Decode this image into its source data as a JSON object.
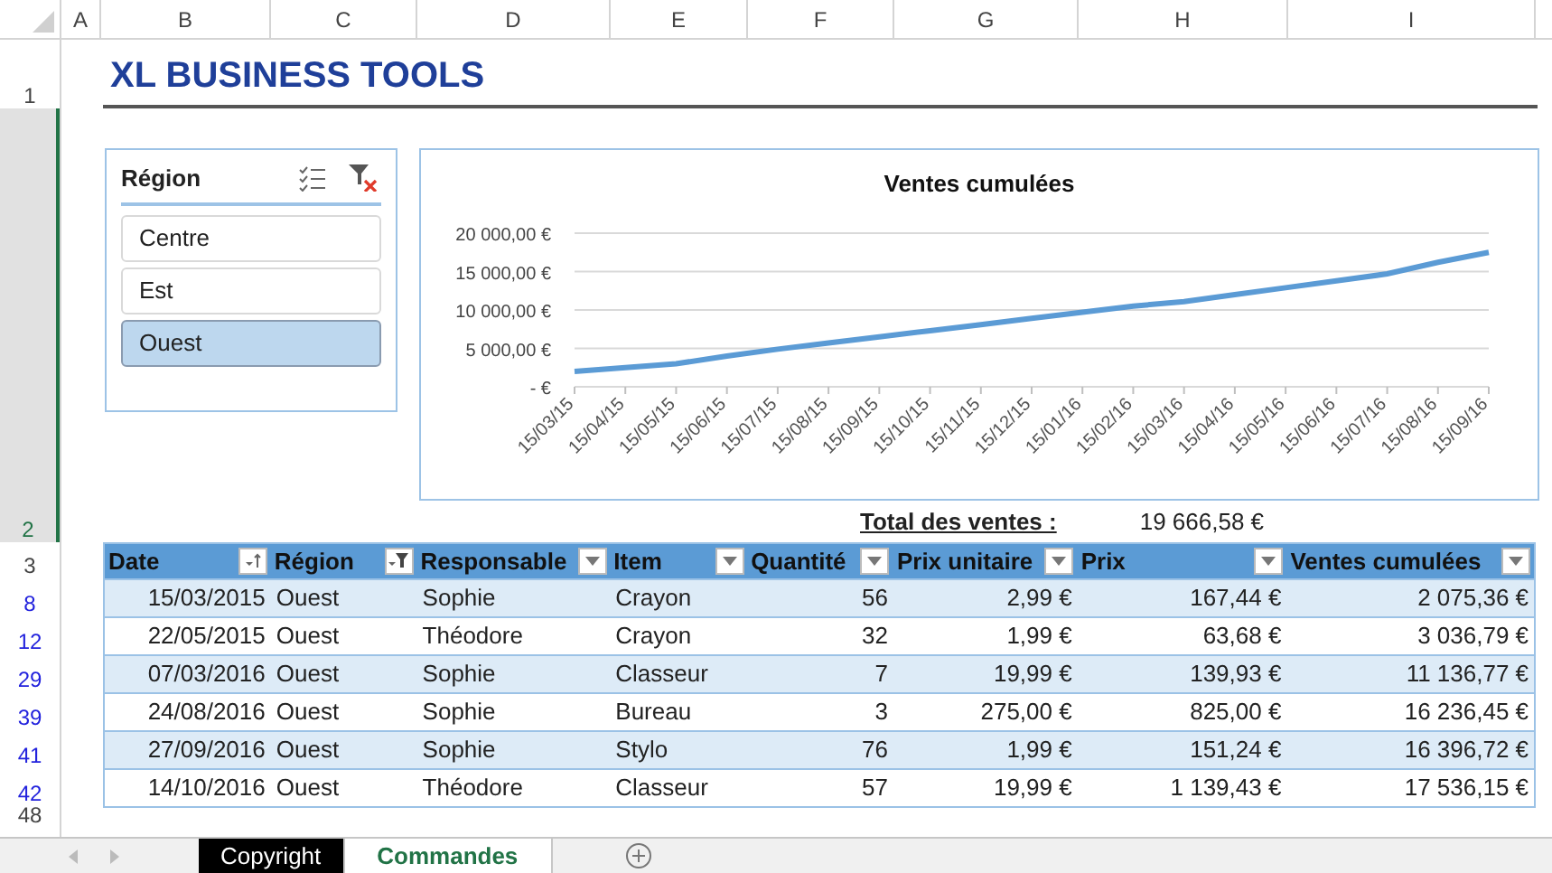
{
  "column_headers": [
    "A",
    "B",
    "C",
    "D",
    "E",
    "F",
    "G",
    "H",
    "I"
  ],
  "row_headers": [
    {
      "label": "1",
      "selected": false,
      "filtered": false
    },
    {
      "label": "2",
      "selected": true,
      "filtered": false
    },
    {
      "label": "3",
      "selected": false,
      "filtered": false
    },
    {
      "label": "8",
      "selected": false,
      "filtered": true
    },
    {
      "label": "12",
      "selected": false,
      "filtered": true
    },
    {
      "label": "29",
      "selected": false,
      "filtered": true
    },
    {
      "label": "39",
      "selected": false,
      "filtered": true
    },
    {
      "label": "41",
      "selected": false,
      "filtered": true
    },
    {
      "label": "42",
      "selected": false,
      "filtered": true
    },
    {
      "label": "48",
      "selected": false,
      "filtered": false
    }
  ],
  "title": "XL BUSINESS TOOLS",
  "slicer": {
    "title": "Région",
    "items": [
      {
        "label": "Centre",
        "selected": false
      },
      {
        "label": "Est",
        "selected": false
      },
      {
        "label": "Ouest",
        "selected": true
      }
    ]
  },
  "chart_data": {
    "type": "line",
    "title": "Ventes cumulées",
    "categories": [
      "15/03/15",
      "15/04/15",
      "15/05/15",
      "15/06/15",
      "15/07/15",
      "15/08/15",
      "15/09/15",
      "15/10/15",
      "15/11/15",
      "15/12/15",
      "15/01/16",
      "15/02/16",
      "15/03/16",
      "15/04/16",
      "15/05/16",
      "15/06/16",
      "15/07/16",
      "15/08/16",
      "15/09/16"
    ],
    "yticks": [
      {
        "value": 0,
        "label": "-  €"
      },
      {
        "value": 5000,
        "label": "5 000,00 €"
      },
      {
        "value": 10000,
        "label": "10 000,00 €"
      },
      {
        "value": 15000,
        "label": "15 000,00 €"
      },
      {
        "value": 20000,
        "label": "20 000,00 €"
      }
    ],
    "ylim": [
      0,
      20000
    ],
    "grid": true,
    "series": [
      {
        "color": "#5b9bd5",
        "values": [
          2000,
          2500,
          3000,
          4000,
          4900,
          5700,
          6500,
          7300,
          8100,
          8900,
          9700,
          10500,
          11100,
          12000,
          12900,
          13800,
          14700,
          16200,
          17500
        ]
      }
    ]
  },
  "total": {
    "label": "Total des ventes :",
    "value": "19 666,58 €"
  },
  "table": {
    "columns": [
      {
        "label": "Date",
        "kind": "sort"
      },
      {
        "label": "Région",
        "kind": "filtered"
      },
      {
        "label": "Responsable",
        "kind": "dropdown"
      },
      {
        "label": "Item",
        "kind": "dropdown"
      },
      {
        "label": "Quantité",
        "kind": "dropdown"
      },
      {
        "label": "Prix unitaire",
        "kind": "dropdown"
      },
      {
        "label": "Prix",
        "kind": "dropdown"
      },
      {
        "label": "Ventes cumulées",
        "kind": "dropdown"
      }
    ],
    "rows": [
      [
        "15/03/2015",
        "Ouest",
        "Sophie",
        "Crayon",
        "56",
        "2,99 €",
        "167,44 €",
        "2 075,36 €"
      ],
      [
        "22/05/2015",
        "Ouest",
        "Théodore",
        "Crayon",
        "32",
        "1,99 €",
        "63,68 €",
        "3 036,79 €"
      ],
      [
        "07/03/2016",
        "Ouest",
        "Sophie",
        "Classeur",
        "7",
        "19,99 €",
        "139,93 €",
        "11 136,77 €"
      ],
      [
        "24/08/2016",
        "Ouest",
        "Sophie",
        "Bureau",
        "3",
        "275,00 €",
        "825,00 €",
        "16 236,45 €"
      ],
      [
        "27/09/2016",
        "Ouest",
        "Sophie",
        "Stylo",
        "76",
        "1,99 €",
        "151,24 €",
        "16 396,72 €"
      ],
      [
        "14/10/2016",
        "Ouest",
        "Théodore",
        "Classeur",
        "57",
        "19,99 €",
        "1 139,43 €",
        "17 536,15 €"
      ]
    ]
  },
  "sheet_tabs": [
    {
      "label": "Copyright",
      "selected": false,
      "color": "#000000"
    },
    {
      "label": "Commandes",
      "selected": true
    }
  ]
}
